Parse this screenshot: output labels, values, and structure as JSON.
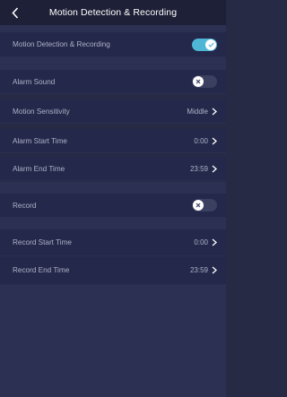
{
  "header": {
    "title": "Motion Detection & Recording"
  },
  "section1": {
    "motion": {
      "label": "Motion Detection & Recording",
      "state": "on"
    }
  },
  "section2": {
    "alarm_sound": {
      "label": "Alarm Sound",
      "state": "off"
    },
    "sensitivity": {
      "label": "Motion Sensitivity",
      "value": "Middle"
    },
    "start": {
      "label": "Alarm Start Time",
      "value": "0:00"
    },
    "end": {
      "label": "Alarm End Time",
      "value": "23:59"
    }
  },
  "section3": {
    "record": {
      "label": "Record",
      "state": "off"
    }
  },
  "section4": {
    "start": {
      "label": "Record Start Time",
      "value": "0:00"
    },
    "end": {
      "label": "Record End Time",
      "value": "23:59"
    }
  },
  "colors": {
    "accent": "#4fb6d6",
    "background": "#262a45",
    "toggle_off": "#3b3f60"
  }
}
